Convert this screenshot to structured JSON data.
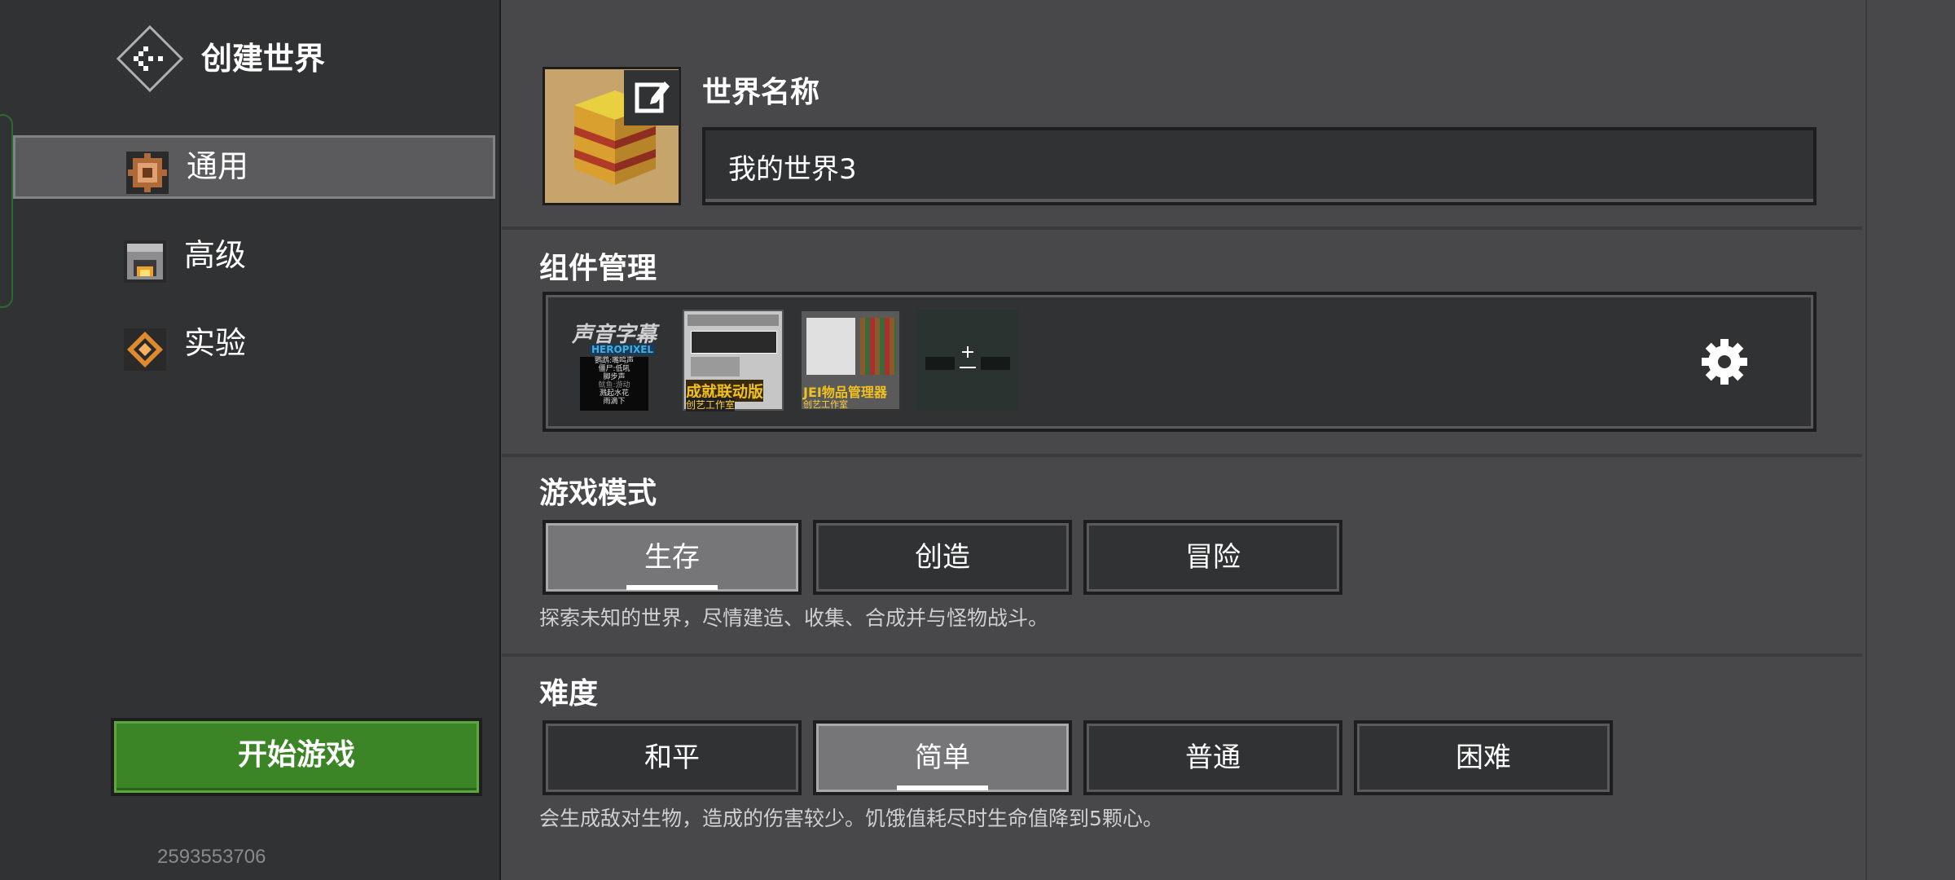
{
  "sidebar": {
    "title": "创建世界",
    "back_icon": "back-arrow-icon",
    "items": [
      {
        "label": "通用",
        "icon": "general-gear-icon",
        "active": true
      },
      {
        "label": "高级",
        "icon": "furnace-icon",
        "active": false
      },
      {
        "label": "实验",
        "icon": "experiment-icon",
        "active": false
      }
    ],
    "start_label": "开始游戏",
    "seed": "2593553706"
  },
  "world": {
    "name_heading": "世界名称",
    "name_value": "我的世界3",
    "thumbnail_icon": "world-block-icon",
    "edit_icon": "edit-image-icon"
  },
  "addons": {
    "heading": "组件管理",
    "packs": [
      {
        "title": "声音字幕",
        "subtitle": "HEROPIXEL",
        "lines": [
          "鹦鹉:嘴鸣声",
          "僵尸:低吼",
          "脚步声",
          "鱿鱼:游动",
          "溅起水花",
          "雨滴下"
        ]
      },
      {
        "title": "成就联动版",
        "studio": "创艺工作室"
      },
      {
        "title": "JEI物品管理器",
        "studio": "创艺工作室"
      },
      {
        "title": "",
        "icon": "add-pack-icon"
      }
    ],
    "settings_icon": "gear-icon"
  },
  "game_mode": {
    "heading": "游戏模式",
    "options": [
      "生存",
      "创造",
      "冒险"
    ],
    "selected": "生存",
    "description": "探索未知的世界，尽情建造、收集、合成并与怪物战斗。"
  },
  "difficulty": {
    "heading": "难度",
    "options": [
      "和平",
      "简单",
      "普通",
      "困难"
    ],
    "selected": "简单",
    "description": "会生成敌对生物，造成的伤害较少。饥饿值耗尽时生命值降到5颗心。"
  },
  "colors": {
    "sidebar_bg": "#313233",
    "main_bg": "#48484a",
    "start_button": "#3c8527",
    "selected_button": "#767678"
  }
}
